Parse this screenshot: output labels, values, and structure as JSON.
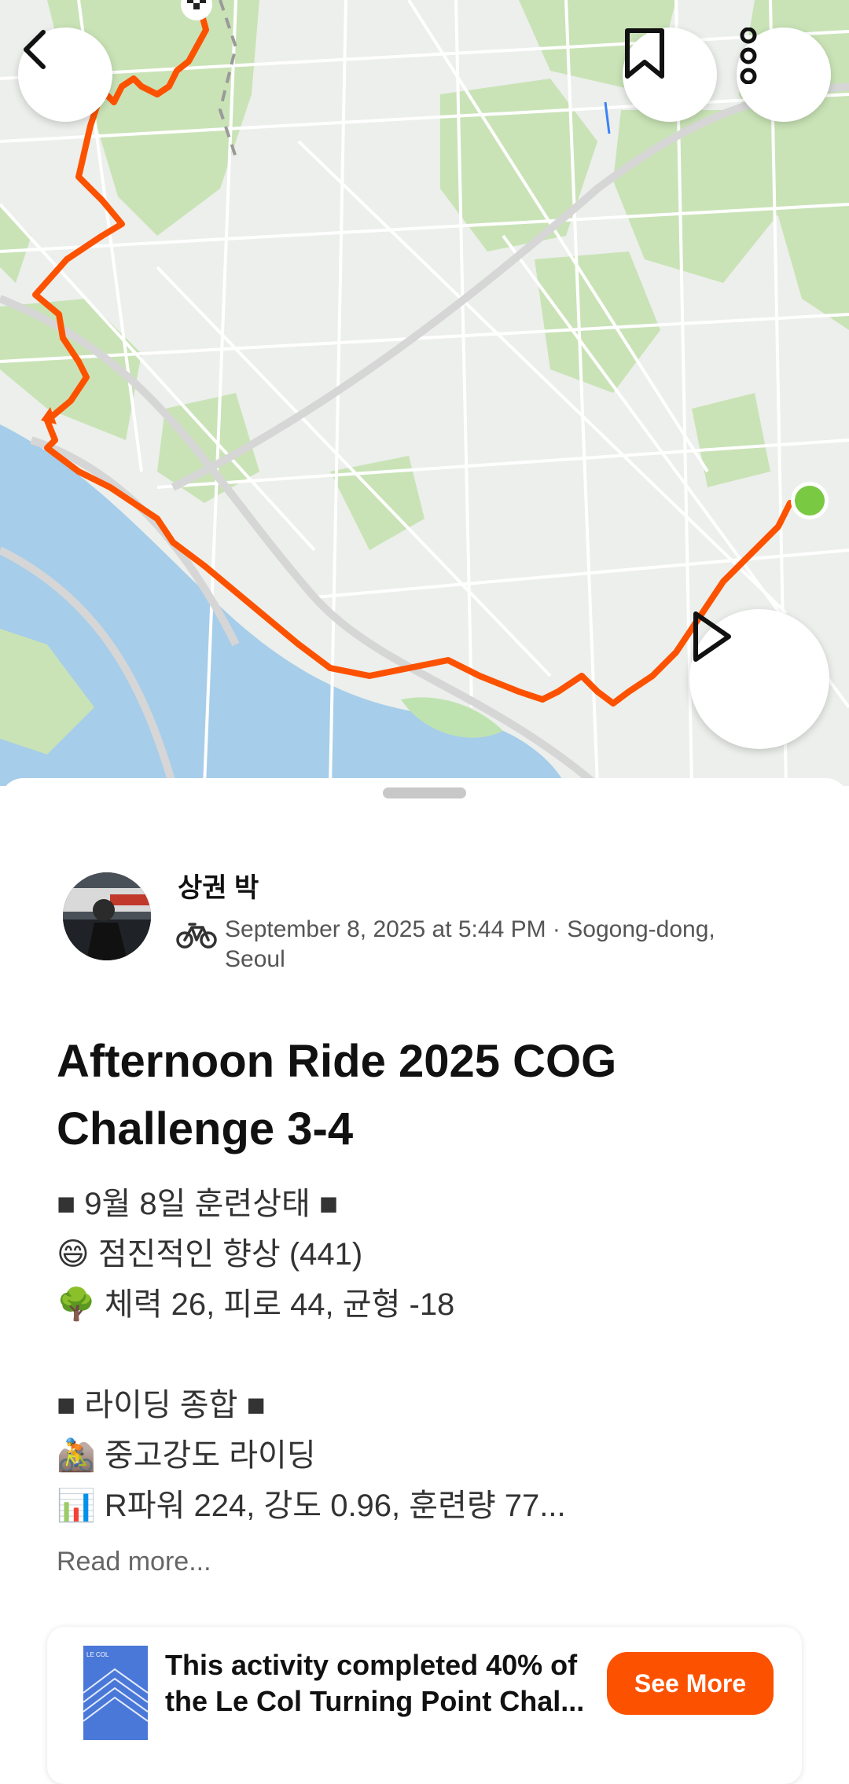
{
  "map": {
    "icons": {
      "back": "chevron-left-icon",
      "save": "bookmark-icon",
      "more": "more-vertical-icon",
      "play": "play-icon"
    },
    "colors": {
      "route": "#fc5200",
      "water": "#a6cdea",
      "park": "#c9e3b6",
      "end_marker": "#7ac943"
    }
  },
  "activity": {
    "athlete_name": "상권 박",
    "sport_icon": "bike-icon",
    "meta": "September 8, 2025 at 5:44 PM · Sogong-dong, Seoul",
    "title": "Afternoon Ride 2025 COG Challenge 3-4",
    "description": [
      "■ 9월 8일 훈련상태 ■",
      "😄 점진적인 향상 (441)",
      "🌳 체력 26, 피로 44, 균형 -18",
      "",
      "■ 라이딩 종합 ■",
      "🚵 중고강도 라이딩",
      "📊 R파워 224, 강도 0.96, 훈련량 77..."
    ],
    "read_more": "Read more..."
  },
  "challenge": {
    "line1": "This activity completed 40% of",
    "line2": "the Le Col Turning Point Chal...",
    "button": "See More",
    "thumb_text": "LE COL",
    "colors": {
      "button": "#fc5200"
    }
  }
}
